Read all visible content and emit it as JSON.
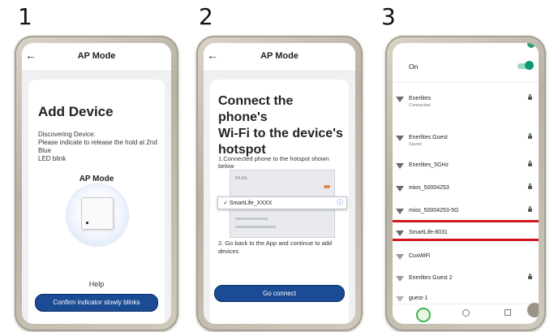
{
  "steps": [
    "1",
    "2",
    "3"
  ],
  "phone1": {
    "title": "AP Mode",
    "heading": "Add Device",
    "description_lines": [
      "Discovering Device:",
      "Please indicate to release the hold at 2nd Blue",
      "LED blink"
    ],
    "mode_label": "AP Mode",
    "help": "Help",
    "confirm_button": "Confirm indicator slowly blinks"
  },
  "phone2": {
    "title": "AP Mode",
    "heading_lines": [
      "Connect the phone's",
      "Wi-Fi to the device's",
      "hotspot"
    ],
    "step1": "1.Connected phone to the hotspot shown below",
    "inner_wlan": "WLAN",
    "inner_network": "SmartLife_XXXX",
    "step2_lines": [
      "2. Go back to the App and continue to add",
      "devices"
    ],
    "go_button": "Go connect",
    "accent": "#1b4b94"
  },
  "phone3": {
    "wifi_toggle_label": "On",
    "networks": [
      {
        "ssid": "Enerlites",
        "sub": "Connected",
        "lock": true
      },
      {
        "ssid": "Enerlites Guest",
        "sub": "Saved",
        "lock": true
      },
      {
        "ssid": "Enerlites_5GHz",
        "sub": "",
        "lock": true
      },
      {
        "ssid": "mios_50004253",
        "sub": "",
        "lock": true
      },
      {
        "ssid": "mios_50004253-5G",
        "sub": "",
        "lock": true
      },
      {
        "ssid": "SmartLife-8031",
        "sub": "",
        "lock": false,
        "highlighted": true
      },
      {
        "ssid": "CoxWiFi",
        "sub": "",
        "lock": false
      },
      {
        "ssid": "Enerlites Guest 2",
        "sub": "",
        "lock": true
      },
      {
        "ssid": "guest-1",
        "sub": "",
        "lock": false
      }
    ],
    "highlight_color": "#d1161f"
  }
}
